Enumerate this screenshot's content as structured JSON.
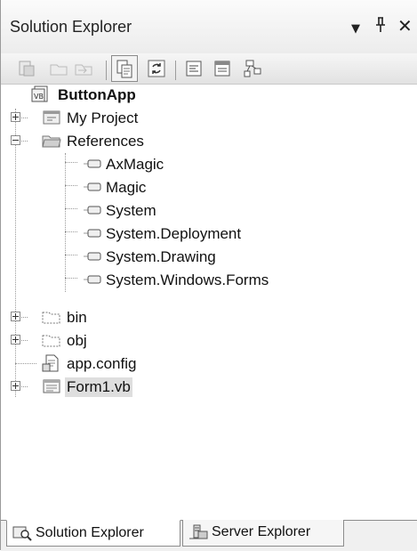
{
  "panel": {
    "title": "Solution Explorer",
    "controls": {
      "dropdown": "▼",
      "pin": "ꟸ",
      "close": "✕"
    }
  },
  "toolbar": {
    "buttons": [
      {
        "icon": "properties-icon"
      },
      {
        "icon": "new-folder-icon"
      },
      {
        "icon": "move-folder-icon"
      },
      {
        "icon": "show-all-files-icon",
        "pressed": true
      },
      {
        "icon": "refresh-icon"
      },
      {
        "icon": "view-code-icon"
      },
      {
        "icon": "view-designer-icon"
      },
      {
        "icon": "class-diagram-icon"
      }
    ]
  },
  "tree": {
    "root": "ButtonApp",
    "my_project": "My Project",
    "references": "References",
    "refs": [
      "AxMagic",
      "Magic",
      "System",
      "System.Deployment",
      "System.Drawing",
      "System.Windows.Forms"
    ],
    "bin": "bin",
    "obj": "obj",
    "app_config": "app.config",
    "form1": "Form1.vb"
  },
  "tabs": {
    "solution_explorer": "Solution Explorer",
    "server_explorer": "Server Explorer"
  }
}
